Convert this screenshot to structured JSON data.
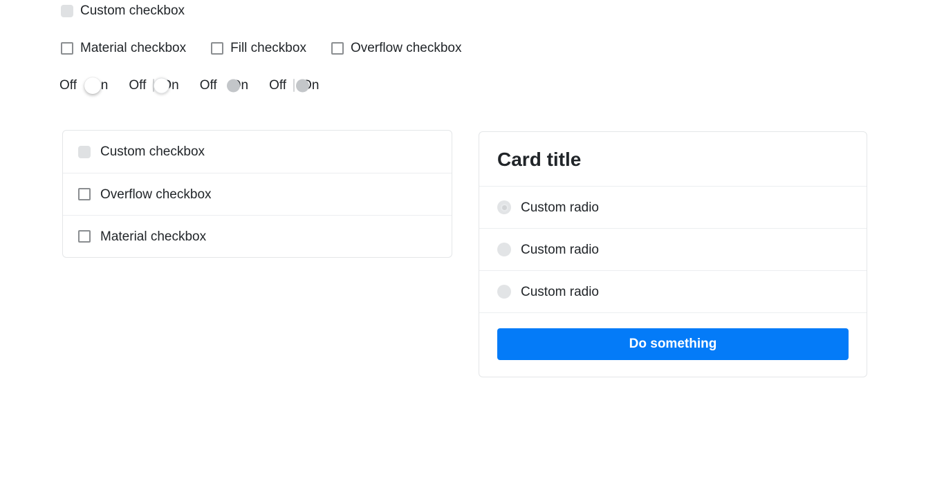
{
  "top_checkbox": {
    "label": "Custom checkbox",
    "style": "custom",
    "checked": false
  },
  "checkbox_row": {
    "items": [
      {
        "label": "Material checkbox",
        "style": "outline",
        "checked": false
      },
      {
        "label": "Fill checkbox",
        "style": "outline",
        "checked": false
      },
      {
        "label": "Overflow checkbox",
        "style": "outline",
        "checked": false
      }
    ]
  },
  "toggle_row": {
    "off_label": "Off",
    "on_label": "On",
    "switches": [
      {
        "state": "off",
        "style": "filled-track-white-thumb"
      },
      {
        "state": "off",
        "style": "outlined-track-white-thumb"
      },
      {
        "state": "off",
        "style": "filled-track-grey-thumb"
      },
      {
        "state": "off",
        "style": "outlined-track-grey-thumb"
      }
    ]
  },
  "list_card": {
    "rows": [
      {
        "label": "Custom checkbox",
        "style": "custom",
        "checked": false
      },
      {
        "label": "Overflow checkbox",
        "style": "outline",
        "checked": false
      },
      {
        "label": "Material checkbox",
        "style": "outline",
        "checked": false
      }
    ]
  },
  "radio_card": {
    "title": "Card title",
    "radios": [
      {
        "label": "Custom radio",
        "selected": true
      },
      {
        "label": "Custom radio",
        "selected": false
      },
      {
        "label": "Custom radio",
        "selected": false
      }
    ],
    "action_button": "Do something"
  },
  "colors": {
    "primary": "#047bf8",
    "text": "#212529",
    "border": "#e4e6e8",
    "divider": "#eceef0",
    "control_fill": "#dfe1e3",
    "control_outline": "#8a8d90"
  }
}
